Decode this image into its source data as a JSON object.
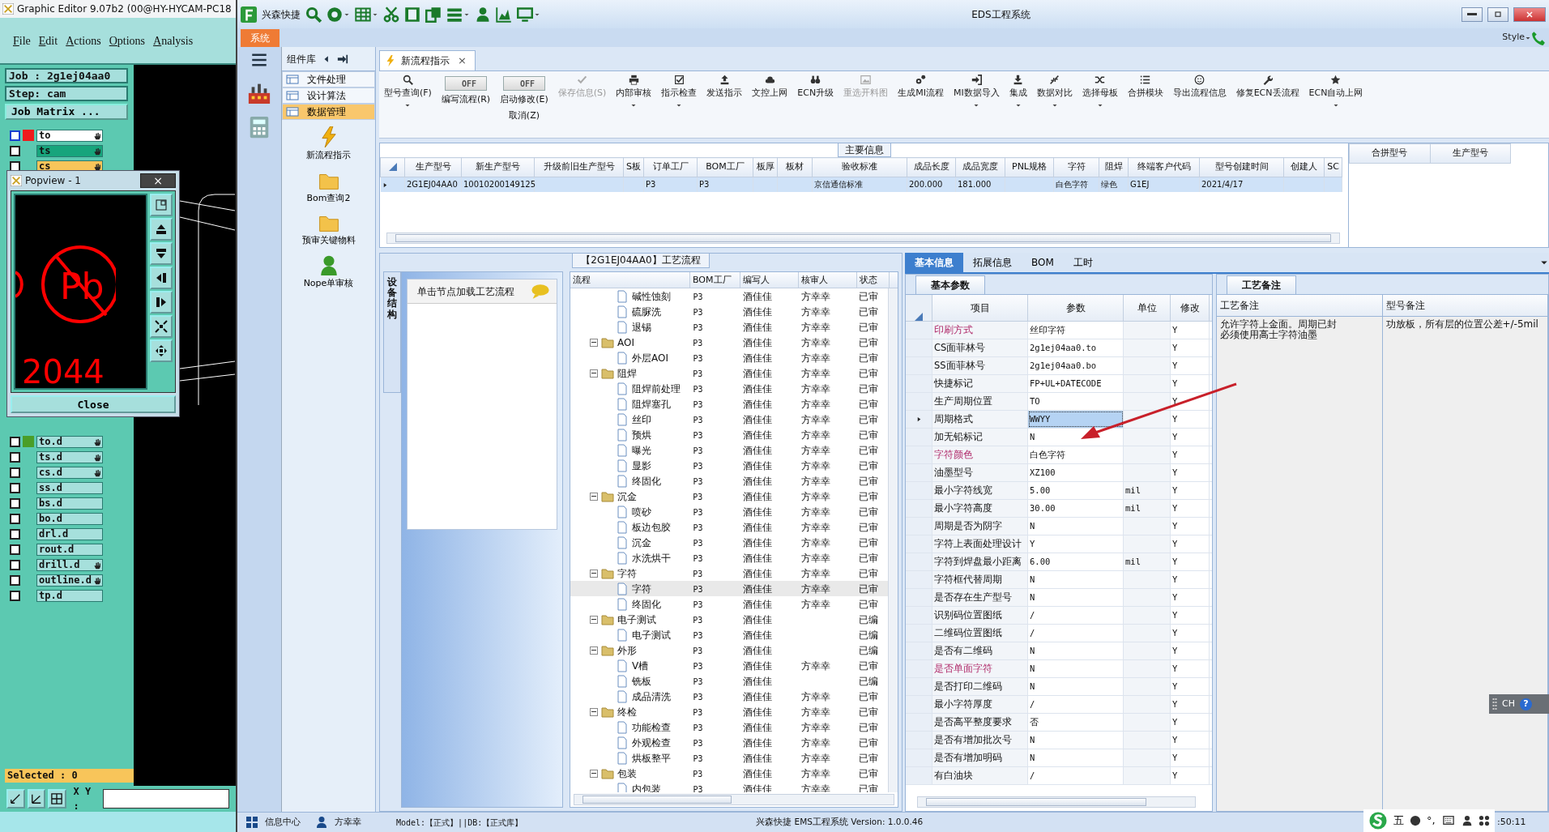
{
  "ge": {
    "title": "Graphic Editor 9.07b2 (00@HY-HYCAM-PC18",
    "menu": [
      "File",
      "Edit",
      "Actions",
      "Options",
      "Analysis"
    ],
    "job": "Job : 2g1ej04aa0",
    "step": "Step: cam",
    "matrix_button": "Job Matrix ...",
    "layers_top": [
      {
        "name": "to",
        "kind": "work",
        "color": "#ee1c1c",
        "checked": false,
        "hand": true
      },
      {
        "name": "ts",
        "kind": "displayed",
        "checked": false,
        "hand": true
      },
      {
        "name": "cs",
        "kind": "affected",
        "checked": false,
        "hand": true
      }
    ],
    "popup": {
      "title": "Popview - 1",
      "close_glyph": "×",
      "view_texts": [
        "Pb",
        "2044"
      ],
      "close": "Close"
    },
    "layers_bottom": [
      {
        "name": "to.d",
        "kind": "normal",
        "color": "#4a9e28",
        "checked": false,
        "hand": true
      },
      {
        "name": "ts.d",
        "kind": "normal",
        "checked": false,
        "hand": true
      },
      {
        "name": "cs.d",
        "kind": "normal",
        "checked": false,
        "hand": true
      },
      {
        "name": "ss.d",
        "kind": "normal",
        "checked": false,
        "hand": false
      },
      {
        "name": "bs.d",
        "kind": "normal",
        "checked": false,
        "hand": false
      },
      {
        "name": "bo.d",
        "kind": "normal",
        "checked": false,
        "hand": false
      },
      {
        "name": "drl.d",
        "kind": "normal",
        "checked": false,
        "hand": false
      },
      {
        "name": "rout.d",
        "kind": "normal",
        "checked": false,
        "hand": false
      },
      {
        "name": "drill.d",
        "kind": "normal",
        "checked": false,
        "hand": true
      },
      {
        "name": "outline.d",
        "kind": "normal",
        "checked": false,
        "hand": true
      },
      {
        "name": "tp.d",
        "kind": "normal",
        "checked": false,
        "hand": false
      }
    ],
    "selected": "Selected : 0",
    "xy_label": "X Y :"
  },
  "eds": {
    "app_name": "兴森快捷",
    "title": "EDS工程系统",
    "menu_tab": "系统",
    "style_label": "Style",
    "panel": {
      "title": "组件库",
      "nav": [
        {
          "label": "文件处理",
          "selected": false
        },
        {
          "label": "设计算法",
          "selected": false
        },
        {
          "label": "数据管理",
          "selected": true
        }
      ],
      "shortcuts": [
        "新流程指示",
        "Bom查询2",
        "预审关键物料",
        "Nope单审核"
      ]
    },
    "doc_tab": {
      "label": "新流程指示",
      "close": "×"
    },
    "toolbar": [
      {
        "kind": "button",
        "label": "型号查询(F)",
        "disabled": false,
        "dropdown": true
      },
      {
        "kind": "toggle",
        "text": "OFF",
        "on": false,
        "label": "编写流程(R)"
      },
      {
        "kind": "toggle",
        "text": "OFF",
        "on": false,
        "label": "启动修改(E)",
        "sub_label": "取消(Z)"
      },
      {
        "kind": "button",
        "label": "保存信息(S)",
        "disabled": true,
        "dropdown": false
      },
      {
        "kind": "button",
        "label": "内部审核",
        "disabled": false,
        "dropdown": true
      },
      {
        "kind": "button",
        "label": "指示检查",
        "disabled": false,
        "dropdown": true
      },
      {
        "kind": "button",
        "label": "发送指示",
        "disabled": false,
        "dropdown": false
      },
      {
        "kind": "button",
        "label": "文控上网",
        "disabled": false,
        "dropdown": false
      },
      {
        "kind": "button",
        "label": "ECN升级",
        "disabled": false,
        "dropdown": false
      },
      {
        "kind": "button",
        "label": "重选开料图",
        "disabled": true,
        "dropdown": false
      },
      {
        "kind": "button",
        "label": "生成MI流程",
        "disabled": false,
        "dropdown": false
      },
      {
        "kind": "button",
        "label": "MI数据导入",
        "disabled": false,
        "dropdown": true
      },
      {
        "kind": "button",
        "label": "集成",
        "disabled": false,
        "dropdown": true
      },
      {
        "kind": "button",
        "label": "数据对比",
        "disabled": false,
        "dropdown": true
      },
      {
        "kind": "button",
        "label": "选择母板",
        "disabled": false,
        "dropdown": true
      },
      {
        "kind": "button",
        "label": "合拼模块",
        "disabled": false,
        "dropdown": false
      },
      {
        "kind": "button",
        "label": "导出流程信息",
        "disabled": false,
        "dropdown": false
      },
      {
        "kind": "button",
        "label": "修复ECN丢流程",
        "disabled": false,
        "dropdown": false
      },
      {
        "kind": "button",
        "label": "ECN自动上网",
        "disabled": false,
        "dropdown": true
      }
    ],
    "main_info": {
      "title": "主要信息",
      "columns": [
        "生产型号",
        "新生产型号",
        "升级前旧生产型号",
        "S板",
        "订单工厂",
        "BOM工厂",
        "板厚",
        "板材",
        "验收标准",
        "成品长度",
        "成品宽度",
        "PNL规格",
        "字符",
        "阻焊",
        "终端客户代码",
        "型号创建时间",
        "创建人",
        "SC"
      ],
      "rows": [
        {
          "selected": true,
          "cells": [
            "2G1EJ04AA0",
            "10010200149125",
            "",
            "",
            "P3",
            "P3",
            "",
            "",
            "京信通信标准",
            "200.000",
            "181.000",
            "",
            "白色字符",
            "绿色",
            "G1EJ",
            "2021/4/17",
            "",
            ""
          ]
        }
      ],
      "side_columns": [
        "合拼型号",
        "生产型号"
      ]
    },
    "flow": {
      "title": "【2G1EJ04AA0】工艺流程",
      "side_tab": "设备结构",
      "hint": "单击节点加载工艺流程",
      "columns": [
        "流程",
        "BOM工厂",
        "编写人",
        "核审人",
        "状态"
      ],
      "tree": [
        {
          "kind": "offscreen",
          "children": [
            {
              "kind": "file",
              "label": "碱性蚀刻",
              "bom": "P3",
              "writer": "酒佳佳",
              "reviewer": "方幸幸",
              "status": "已审",
              "selected": false
            },
            {
              "kind": "file",
              "label": "硫脲洗",
              "bom": "P3",
              "writer": "酒佳佳",
              "reviewer": "方幸幸",
              "status": "已审",
              "selected": false
            },
            {
              "kind": "file",
              "label": "退锡",
              "bom": "P3",
              "writer": "酒佳佳",
              "reviewer": "方幸幸",
              "status": "已审",
              "selected": false
            }
          ]
        },
        {
          "kind": "folder",
          "label": "AOI",
          "bom": "P3",
          "writer": "酒佳佳",
          "reviewer": "方幸幸",
          "status": "已审",
          "expanded": true,
          "selected": false,
          "children": [
            {
              "kind": "file",
              "label": "外层AOI",
              "bom": "P3",
              "writer": "酒佳佳",
              "reviewer": "方幸幸",
              "status": "已审",
              "selected": false
            }
          ]
        },
        {
          "kind": "folder",
          "label": "阻焊",
          "bom": "P3",
          "writer": "酒佳佳",
          "reviewer": "方幸幸",
          "status": "已审",
          "expanded": true,
          "selected": false,
          "children": [
            {
              "kind": "file",
              "label": "阻焊前处理",
              "bom": "P3",
              "writer": "酒佳佳",
              "reviewer": "方幸幸",
              "status": "已审",
              "selected": false
            },
            {
              "kind": "file",
              "label": "阻焊塞孔",
              "bom": "P3",
              "writer": "酒佳佳",
              "reviewer": "方幸幸",
              "status": "已审",
              "selected": false
            },
            {
              "kind": "file",
              "label": "丝印",
              "bom": "P3",
              "writer": "酒佳佳",
              "reviewer": "方幸幸",
              "status": "已审",
              "selected": false
            },
            {
              "kind": "file",
              "label": "预烘",
              "bom": "P3",
              "writer": "酒佳佳",
              "reviewer": "方幸幸",
              "status": "已审",
              "selected": false
            },
            {
              "kind": "file",
              "label": "曝光",
              "bom": "P3",
              "writer": "酒佳佳",
              "reviewer": "方幸幸",
              "status": "已审",
              "selected": false
            },
            {
              "kind": "file",
              "label": "显影",
              "bom": "P3",
              "writer": "酒佳佳",
              "reviewer": "方幸幸",
              "status": "已审",
              "selected": false
            },
            {
              "kind": "file",
              "label": "终固化",
              "bom": "P3",
              "writer": "酒佳佳",
              "reviewer": "方幸幸",
              "status": "已审",
              "selected": false
            }
          ]
        },
        {
          "kind": "folder",
          "label": "沉金",
          "bom": "P3",
          "writer": "酒佳佳",
          "reviewer": "方幸幸",
          "status": "已审",
          "expanded": true,
          "selected": false,
          "children": [
            {
              "kind": "file",
              "label": "喷砂",
              "bom": "P3",
              "writer": "酒佳佳",
              "reviewer": "方幸幸",
              "status": "已审",
              "selected": false
            },
            {
              "kind": "file",
              "label": "板边包胶",
              "bom": "P3",
              "writer": "酒佳佳",
              "reviewer": "方幸幸",
              "status": "已审",
              "selected": false
            },
            {
              "kind": "file",
              "label": "沉金",
              "bom": "P3",
              "writer": "酒佳佳",
              "reviewer": "方幸幸",
              "status": "已审",
              "selected": false
            },
            {
              "kind": "file",
              "label": "水洗烘干",
              "bom": "P3",
              "writer": "酒佳佳",
              "reviewer": "方幸幸",
              "status": "已审",
              "selected": false
            }
          ]
        },
        {
          "kind": "folder",
          "label": "字符",
          "bom": "P3",
          "writer": "酒佳佳",
          "reviewer": "方幸幸",
          "status": "已审",
          "expanded": true,
          "selected": false,
          "children": [
            {
              "kind": "file",
              "label": "字符",
              "bom": "P3",
              "writer": "酒佳佳",
              "reviewer": "方幸幸",
              "status": "已审",
              "selected": true
            },
            {
              "kind": "file",
              "label": "终固化",
              "bom": "P3",
              "writer": "酒佳佳",
              "reviewer": "方幸幸",
              "status": "已审",
              "selected": false
            }
          ]
        },
        {
          "kind": "folder",
          "label": "电子测试",
          "bom": "P3",
          "writer": "酒佳佳",
          "status": "已编",
          "expanded": true,
          "selected": false,
          "children": [
            {
              "kind": "file",
              "label": "电子测试",
              "bom": "P3",
              "writer": "酒佳佳",
              "status": "已编",
              "selected": false
            }
          ]
        },
        {
          "kind": "folder",
          "label": "外形",
          "bom": "P3",
          "writer": "酒佳佳",
          "status": "已编",
          "expanded": true,
          "selected": false,
          "children": [
            {
              "kind": "file",
              "label": "V槽",
              "bom": "P3",
              "writer": "酒佳佳",
              "reviewer": "方幸幸",
              "status": "已审",
              "selected": false
            },
            {
              "kind": "file",
              "label": "铣板",
              "bom": "P3",
              "writer": "酒佳佳",
              "status": "已编",
              "selected": false
            },
            {
              "kind": "file",
              "label": "成品清洗",
              "bom": "P3",
              "writer": "酒佳佳",
              "reviewer": "方幸幸",
              "status": "已审",
              "selected": false
            }
          ]
        },
        {
          "kind": "folder",
          "label": "终检",
          "bom": "P3",
          "writer": "酒佳佳",
          "reviewer": "方幸幸",
          "status": "已审",
          "expanded": true,
          "selected": false,
          "children": [
            {
              "kind": "file",
              "label": "功能检查",
              "bom": "P3",
              "writer": "酒佳佳",
              "reviewer": "方幸幸",
              "status": "已审",
              "selected": false
            },
            {
              "kind": "file",
              "label": "外观检查",
              "bom": "P3",
              "writer": "酒佳佳",
              "reviewer": "方幸幸",
              "status": "已审",
              "selected": false
            },
            {
              "kind": "file",
              "label": "烘板整平",
              "bom": "P3",
              "writer": "酒佳佳",
              "reviewer": "方幸幸",
              "status": "已审",
              "selected": false
            }
          ]
        },
        {
          "kind": "folder",
          "label": "包装",
          "bom": "P3",
          "writer": "酒佳佳",
          "reviewer": "方幸幸",
          "status": "已审",
          "expanded": true,
          "selected": false,
          "children": [
            {
              "kind": "file",
              "label": "内包装",
              "bom": "P3",
              "writer": "酒佳佳",
              "reviewer": "方幸幸",
              "status": "已审",
              "selected": false
            }
          ]
        }
      ]
    },
    "props": {
      "tabs": [
        {
          "label": "基本信息",
          "selected": true
        },
        {
          "label": "拓展信息",
          "selected": false
        },
        {
          "label": "BOM",
          "selected": false
        },
        {
          "label": "工时",
          "selected": false
        }
      ],
      "sub_tab": "基本参数",
      "columns": [
        "项目",
        "参数",
        "单位",
        "修改"
      ],
      "rows": [
        {
          "item": "印刷方式",
          "value": "丝印字符",
          "unit": "",
          "modified": "Y",
          "flagged": true,
          "selected": false
        },
        {
          "item": "CS面菲林号",
          "value": "2g1ej04aa0.to",
          "unit": "",
          "modified": "Y",
          "flagged": false,
          "selected": false
        },
        {
          "item": "SS面菲林号",
          "value": "2g1ej04aa0.bo",
          "unit": "",
          "modified": "Y",
          "flagged": false,
          "selected": false
        },
        {
          "item": "快捷标记",
          "value": "FP+UL+DATECODE",
          "unit": "",
          "modified": "Y",
          "flagged": false,
          "selected": false
        },
        {
          "item": "生产周期位置",
          "value": "TO",
          "unit": "",
          "modified": "Y",
          "flagged": false,
          "selected": false
        },
        {
          "item": "周期格式",
          "value": "WWYY",
          "unit": "",
          "modified": "Y",
          "flagged": false,
          "selected": true
        },
        {
          "item": "加无铅标记",
          "value": "N",
          "unit": "",
          "modified": "Y",
          "flagged": false,
          "selected": false
        },
        {
          "item": "字符颜色",
          "value": "白色字符",
          "unit": "",
          "modified": "Y",
          "flagged": true,
          "selected": false
        },
        {
          "item": "油墨型号",
          "value": "XZ100",
          "unit": "",
          "modified": "Y",
          "flagged": false,
          "selected": false
        },
        {
          "item": "最小字符线宽",
          "value": "5.00",
          "unit": "mil",
          "modified": "Y",
          "flagged": false,
          "selected": false
        },
        {
          "item": "最小字符高度",
          "value": "30.00",
          "unit": "mil",
          "modified": "Y",
          "flagged": false,
          "selected": false
        },
        {
          "item": "周期是否为阴字",
          "value": "N",
          "unit": "",
          "modified": "Y",
          "flagged": false,
          "selected": false
        },
        {
          "item": "字符上表面处理设计",
          "value": "Y",
          "unit": "",
          "modified": "Y",
          "flagged": false,
          "selected": false
        },
        {
          "item": "字符到焊盘最小距离",
          "value": "6.00",
          "unit": "mil",
          "modified": "Y",
          "flagged": false,
          "selected": false
        },
        {
          "item": "字符框代替周期",
          "value": "N",
          "unit": "",
          "modified": "Y",
          "flagged": false,
          "selected": false
        },
        {
          "item": "是否存在生产型号",
          "value": "N",
          "unit": "",
          "modified": "Y",
          "flagged": false,
          "selected": false
        },
        {
          "item": "识别码位置图纸",
          "value": "/",
          "unit": "",
          "modified": "Y",
          "flagged": false,
          "selected": false
        },
        {
          "item": "二维码位置图纸",
          "value": "/",
          "unit": "",
          "modified": "Y",
          "flagged": false,
          "selected": false
        },
        {
          "item": "是否有二维码",
          "value": "N",
          "unit": "",
          "modified": "Y",
          "flagged": false,
          "selected": false
        },
        {
          "item": "是否单面字符",
          "value": "N",
          "unit": "",
          "modified": "Y",
          "flagged": true,
          "selected": false
        },
        {
          "item": "是否打印二维码",
          "value": "N",
          "unit": "",
          "modified": "Y",
          "flagged": false,
          "selected": false
        },
        {
          "item": "最小字符厚度",
          "value": "/",
          "unit": "",
          "modified": "Y",
          "flagged": false,
          "selected": false
        },
        {
          "item": "是否高平整度要求",
          "value": "否",
          "unit": "",
          "modified": "Y",
          "flagged": false,
          "selected": false
        },
        {
          "item": "是否有增加批次号",
          "value": "N",
          "unit": "",
          "modified": "Y",
          "flagged": false,
          "selected": false
        },
        {
          "item": "是否有增加明码",
          "value": "N",
          "unit": "",
          "modified": "Y",
          "flagged": false,
          "selected": false
        },
        {
          "item": "有白油块",
          "value": "/",
          "unit": "",
          "modified": "Y",
          "flagged": false,
          "selected": false
        }
      ]
    },
    "notes": {
      "tab": "工艺备注",
      "columns": [
        "工艺备注",
        "型号备注"
      ],
      "process_note": [
        "允许字符上金面。周期已封",
        "必须使用高士字符油墨"
      ],
      "model_note": "功放板，所有层的位置公差+/-5mil"
    },
    "status": {
      "info_center": "信息中心",
      "user": "方幸幸",
      "model": "Model:【正式】||DB:【正式库】",
      "version": "兴森快捷 EMS工程系统 Version: 1.0.0.46"
    }
  },
  "ime": {
    "lang": "CH",
    "help": "?",
    "mode": "五",
    "punct": "°,"
  },
  "clock": ":50:11"
}
